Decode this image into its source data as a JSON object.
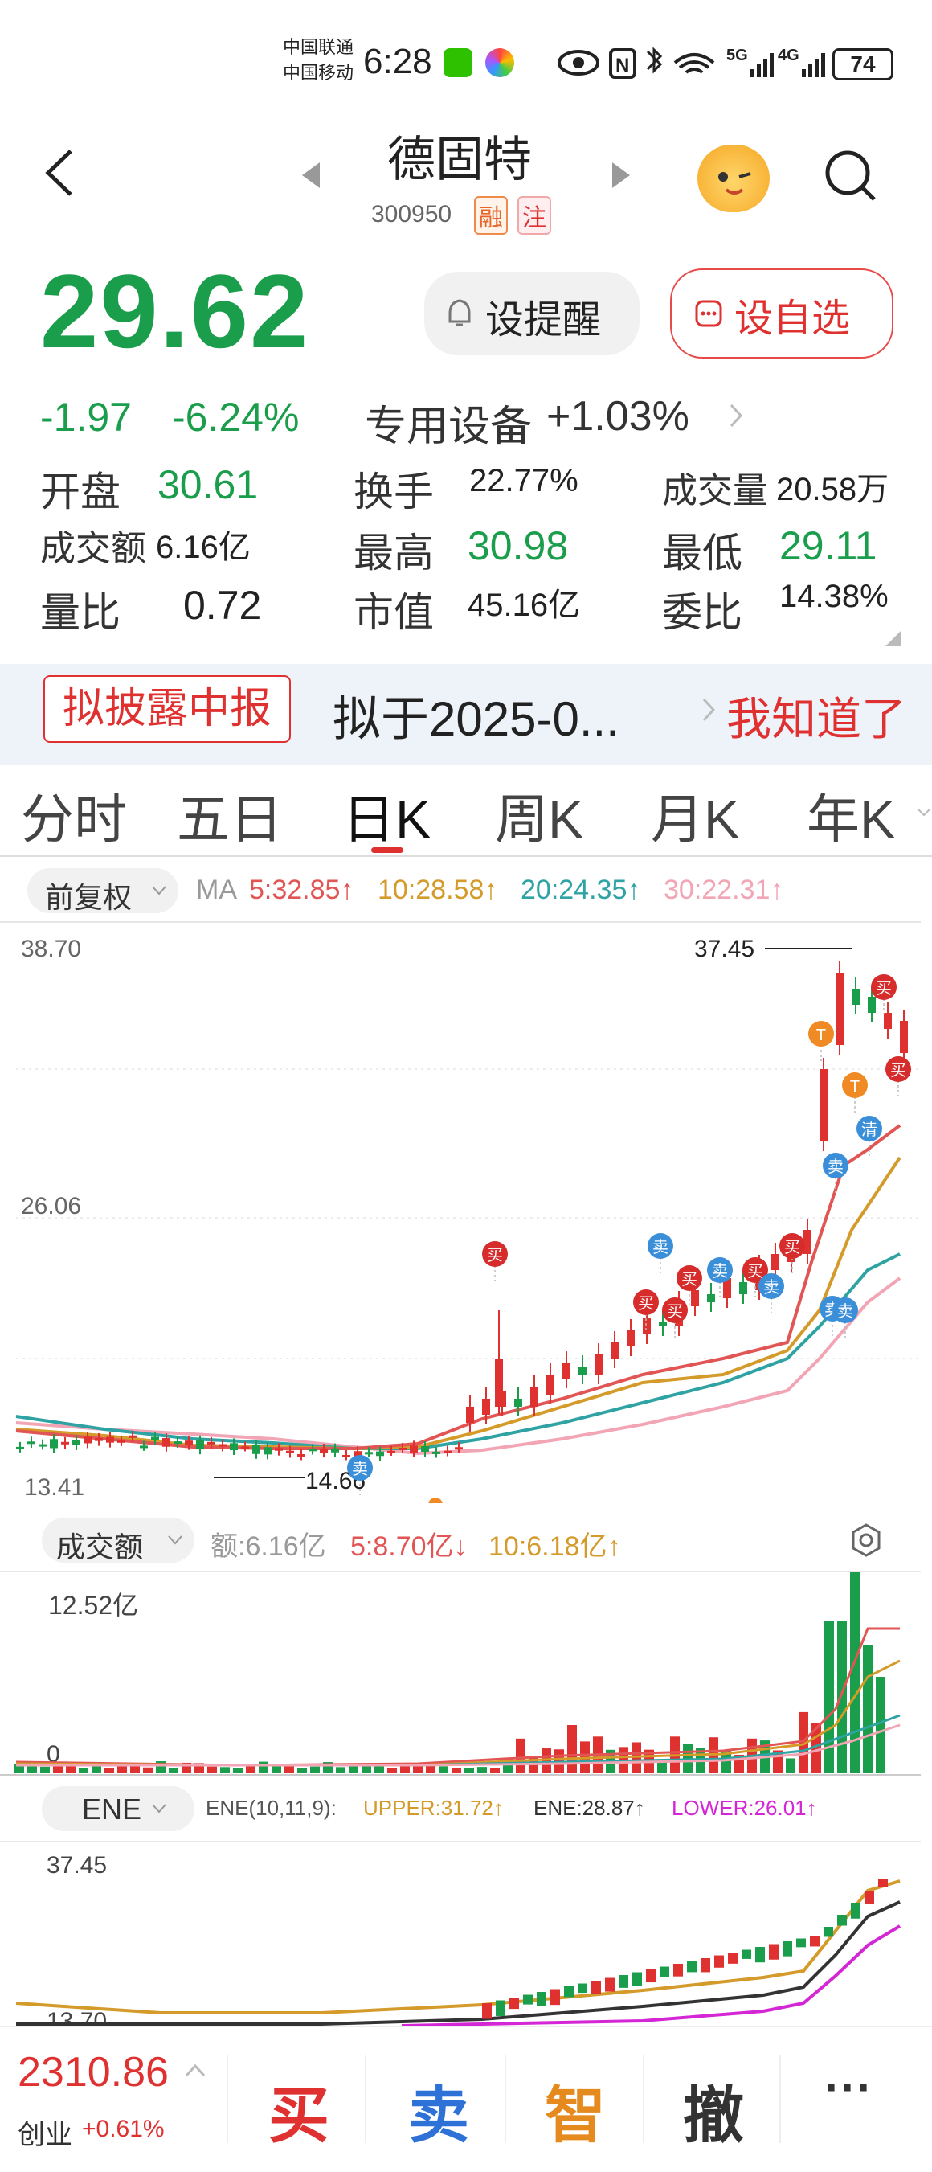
{
  "status_bar": {
    "carrier1": "中国联通",
    "carrier2": "中国移动",
    "time": "6:28",
    "net1": "5G",
    "net2": "4G",
    "battery": "74"
  },
  "header": {
    "name": "德固特",
    "code": "300950",
    "tag1": "融",
    "tag2": "注"
  },
  "quote": {
    "price": "29.62",
    "change": "-1.97",
    "change_pct": "-6.24%",
    "sector": "专用设备",
    "sector_pct": "+1.03%",
    "remind_button": "设提醒",
    "watch_button": "设自选"
  },
  "stats": [
    {
      "label": "开盘",
      "value": "30.61",
      "color": "green"
    },
    {
      "label": "换手",
      "value": "22.77%",
      "color": "black"
    },
    {
      "label": "成交量",
      "value": "20.58万",
      "color": "black"
    },
    {
      "label": "成交额",
      "value": "6.16亿",
      "color": "black"
    },
    {
      "label": "最高",
      "value": "30.98",
      "color": "green"
    },
    {
      "label": "最低",
      "value": "29.11",
      "color": "green"
    },
    {
      "label": "量比",
      "value": "0.72",
      "color": "black"
    },
    {
      "label": "市值",
      "value": "45.16亿",
      "color": "black"
    },
    {
      "label": "委比",
      "value": "14.38%",
      "color": "red"
    }
  ],
  "banner": {
    "tag": "拟披露中报",
    "text": "拟于2025-0...",
    "action": "我知道了"
  },
  "tabs": [
    "分时",
    "五日",
    "日K",
    "周K",
    "月K",
    "年K"
  ],
  "active_tab": "日K",
  "kline": {
    "adjust": "前复权",
    "ma_label": "MA",
    "ma5": "5:32.85↑",
    "ma10": "10:28.58↑",
    "ma20": "20:24.35↑",
    "ma30": "30:22.31↑",
    "y_top": "38.70",
    "y_mid": "26.06",
    "y_bot": "13.41",
    "high_label": "37.45",
    "low_label": "14.66",
    "signals": [
      "卖",
      "买",
      "卖",
      "买",
      "卖",
      "买",
      "卖",
      "买",
      "买",
      "买",
      "卖",
      "卖",
      "T",
      "T",
      "买",
      "清",
      "买",
      "卖"
    ]
  },
  "volume": {
    "selector": "成交额",
    "amount": "额:6.16亿",
    "ma5": "5:8.70亿↓",
    "ma10": "10:6.18亿↑",
    "y_top": "12.52亿",
    "y_bot": "0"
  },
  "ene": {
    "selector": "ENE",
    "params": "ENE(10,11,9):",
    "upper": "UPPER:31.72↑",
    "ene": "ENE:28.87↑",
    "lower": "LOWER:26.01↑",
    "y_top": "37.45",
    "y_bot": "13.70"
  },
  "footer": {
    "index_value": "2310.86",
    "index_name": "创业",
    "index_pct": "+0.61%",
    "buy": "买",
    "sell": "卖",
    "smart": "智",
    "cancel": "撤",
    "more": "···"
  },
  "colors": {
    "up": "#e03131",
    "down": "#1a9e4b",
    "ma5": "#e25555",
    "ma10": "#d49a2a",
    "ma20": "#2fa3a3",
    "ma30": "#f2a5b5"
  }
}
